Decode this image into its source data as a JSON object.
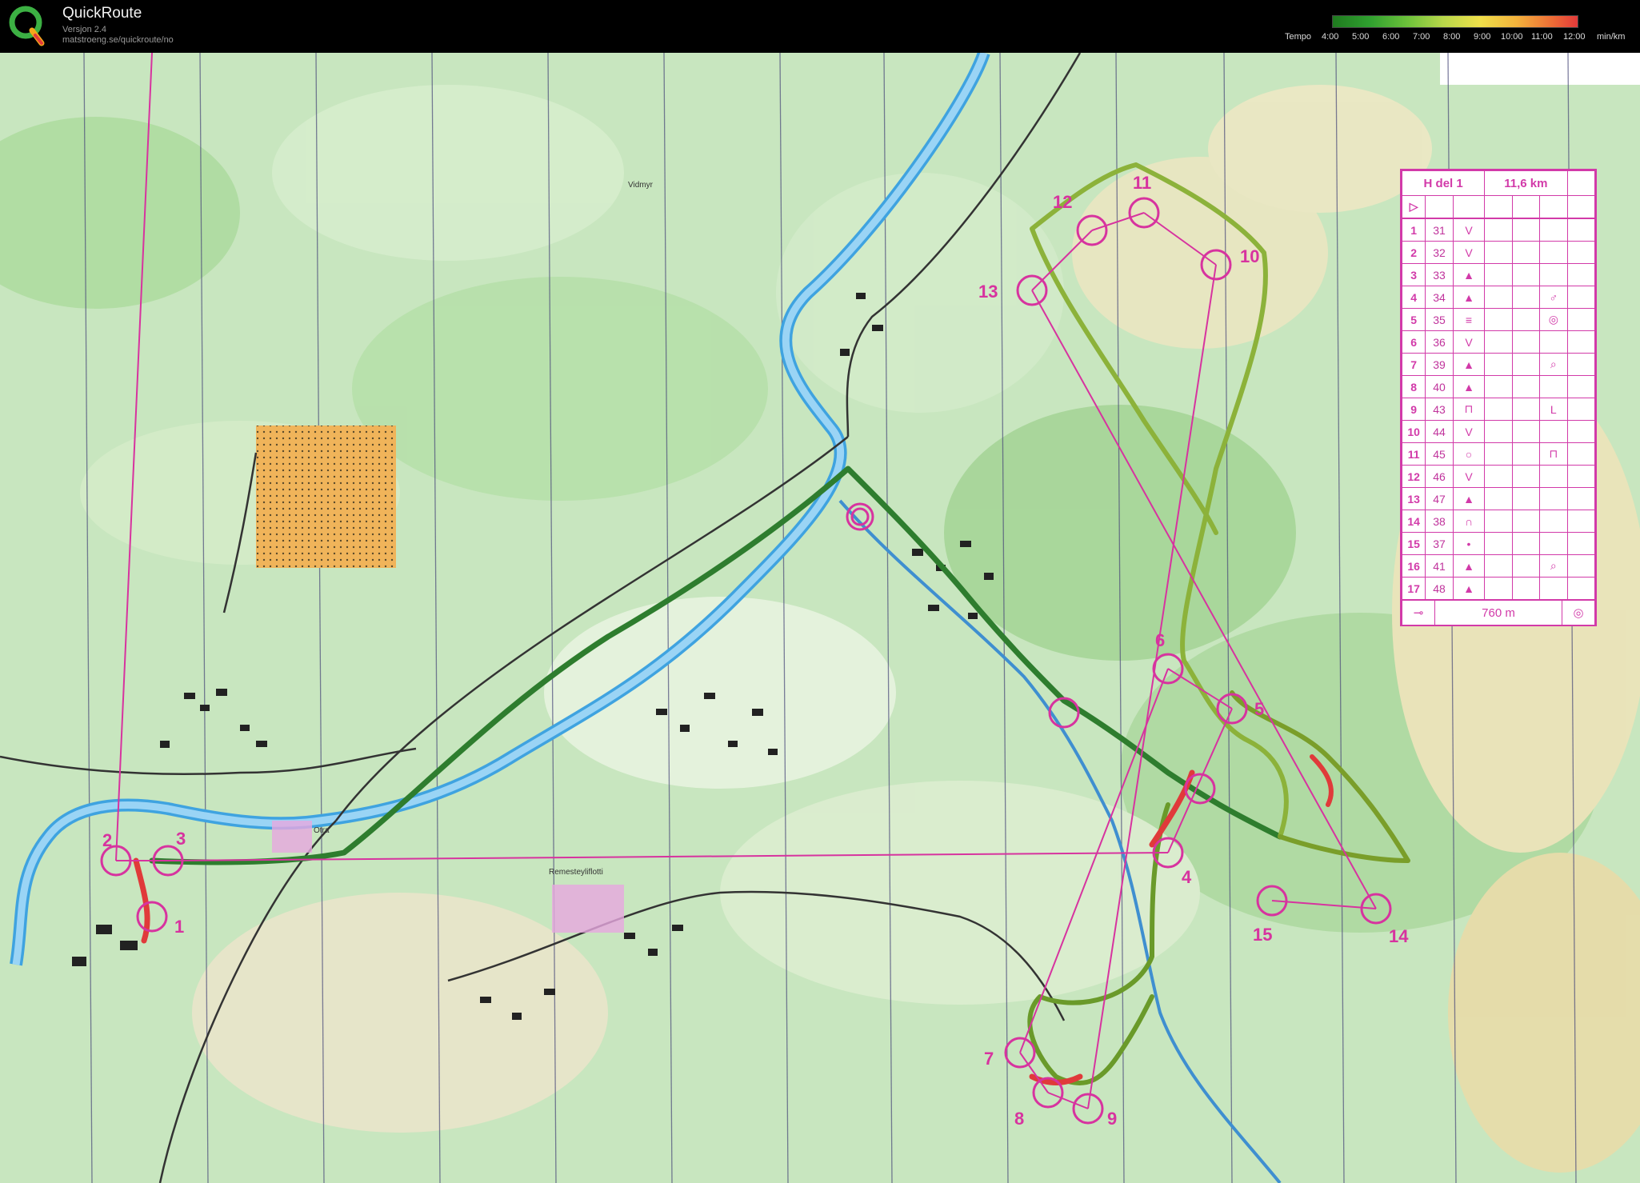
{
  "app": {
    "title": "QuickRoute",
    "version": "Versjon 2.4",
    "url": "matstroeng.se/quickroute/no"
  },
  "tempo_legend": {
    "label": "Tempo",
    "ticks": [
      "4:00",
      "5:00",
      "6:00",
      "7:00",
      "8:00",
      "9:00",
      "10:00",
      "11:00",
      "12:00"
    ],
    "unit": "min/km",
    "colors": [
      "#1f7a1f",
      "#2fa02f",
      "#6ac13a",
      "#b8d84a",
      "#efe04a",
      "#f3b33c",
      "#ee6b36",
      "#e23a3a"
    ]
  },
  "map": {
    "place_names": [
      "Vidmyr",
      "Otra",
      "Remesteyliflotti"
    ],
    "controls": [
      "1",
      "2",
      "3",
      "4",
      "5",
      "6",
      "7",
      "8",
      "9",
      "10",
      "11",
      "12",
      "13",
      "14",
      "15"
    ],
    "colors": {
      "course": "#d7339f",
      "route_fast": "#2e8b2e",
      "route_slow": "#e03a3a"
    }
  },
  "control_description": {
    "class": "H del 1",
    "length": "11,6 km",
    "rows": [
      {
        "n": "1",
        "code": "31",
        "what": "V",
        "extra": ""
      },
      {
        "n": "2",
        "code": "32",
        "what": "V",
        "extra": ""
      },
      {
        "n": "3",
        "code": "33",
        "what": "▲",
        "extra": ""
      },
      {
        "n": "4",
        "code": "34",
        "what": "▲",
        "extra": "♂"
      },
      {
        "n": "5",
        "code": "35",
        "what": "≡",
        "extra": "◎"
      },
      {
        "n": "6",
        "code": "36",
        "what": "V",
        "extra": ""
      },
      {
        "n": "7",
        "code": "39",
        "what": "▲",
        "extra": "⌕"
      },
      {
        "n": "8",
        "code": "40",
        "what": "▲",
        "extra": ""
      },
      {
        "n": "9",
        "code": "43",
        "what": "⊓",
        "extra": "L"
      },
      {
        "n": "10",
        "code": "44",
        "what": "V",
        "extra": ""
      },
      {
        "n": "11",
        "code": "45",
        "what": "○",
        "extra": "⊓"
      },
      {
        "n": "12",
        "code": "46",
        "what": "V",
        "extra": ""
      },
      {
        "n": "13",
        "code": "47",
        "what": "▲",
        "extra": ""
      },
      {
        "n": "14",
        "code": "38",
        "what": "∩",
        "extra": ""
      },
      {
        "n": "15",
        "code": "37",
        "what": "•",
        "extra": ""
      },
      {
        "n": "16",
        "code": "41",
        "what": "▲",
        "extra": "⌕"
      },
      {
        "n": "17",
        "code": "48",
        "what": "▲",
        "extra": ""
      }
    ],
    "finish_distance": "760 m"
  }
}
